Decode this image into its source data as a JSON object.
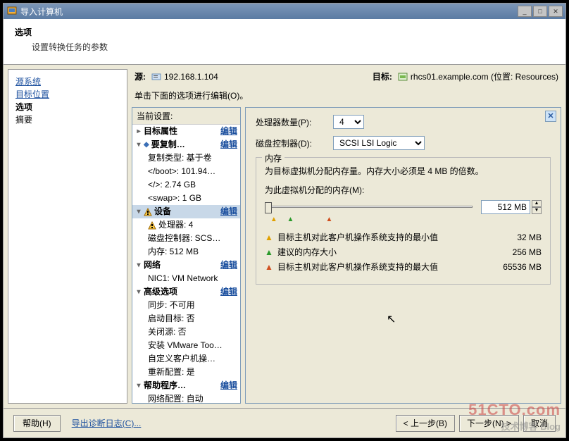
{
  "window": {
    "title": "导入计算机"
  },
  "header": {
    "title": "选项",
    "subtitle": "设置转换任务的参数"
  },
  "left_nav": {
    "items": [
      {
        "label": "源系统",
        "link": true
      },
      {
        "label": "目标位置",
        "link": true
      },
      {
        "label": "选项",
        "link": false,
        "current": true
      },
      {
        "label": "摘要",
        "link": false
      }
    ]
  },
  "info": {
    "source_label": "源:",
    "source_value": "192.168.1.104",
    "target_label": "目标:",
    "target_value": "rhcs01.example.com (位置: Resources)"
  },
  "instruction": "单击下面的选项进行编辑(O)。",
  "tree": {
    "header": "当前设置:",
    "edit_label": "编辑",
    "groups": {
      "target_props": "目标属性",
      "to_copy": "要复制…",
      "devices": "设备",
      "network": "网络",
      "advanced": "高级选项",
      "helpers": "帮助程序…"
    },
    "items": {
      "copy_type": "复制类型: 基于卷",
      "boot": "</boot>: 101.94…",
      "root": "</>: 2.74 GB",
      "swap": "<swap>: 1 GB",
      "cpu": "处理器: 4",
      "disk_ctrl": "磁盘控制器: SCS…",
      "memory": "内存: 512 MB",
      "nic1": "NIC1: VM Network",
      "sync": "同步: 不可用",
      "boot_target": "启动目标: 否",
      "close_src": "关闭源: 否",
      "vmtools": "安装 VMware Too…",
      "customize": "自定义客户机操…",
      "reconfig": "重新配置: 是",
      "netcfg": "网络配置: 自动"
    }
  },
  "config": {
    "cpu_label": "处理器数量(P):",
    "cpu_value": "4",
    "disk_label": "磁盘控制器(D):",
    "disk_value": "SCSI LSI Logic",
    "mem_group": "内存",
    "mem_hint": "为目标虚拟机分配内存量。内存大小必须是 4 MB 的倍数。",
    "mem_alloc_label": "为此虚拟机分配的内存(M):",
    "mem_value": "512 MB",
    "legend": {
      "min": {
        "text": "目标主机对此客户机操作系统支持的最小值",
        "value": "32 MB"
      },
      "rec": {
        "text": "建议的内存大小",
        "value": "256 MB"
      },
      "max": {
        "text": "目标主机对此客户机操作系统支持的最大值",
        "value": "65536 MB"
      }
    }
  },
  "footer": {
    "help": "帮助(H)",
    "export": "导出诊断日志(C)...",
    "back": "< 上一步(B)",
    "next": "下一步(N) >",
    "cancel": "取消"
  },
  "watermark": {
    "big": "51CTO.com",
    "small": "技术博客  Blog"
  },
  "chart_data": {
    "type": "bar",
    "title": "Memory slider",
    "min_mb": 32,
    "recommended_mb": 256,
    "current_mb": 512,
    "max_mb": 65536
  }
}
